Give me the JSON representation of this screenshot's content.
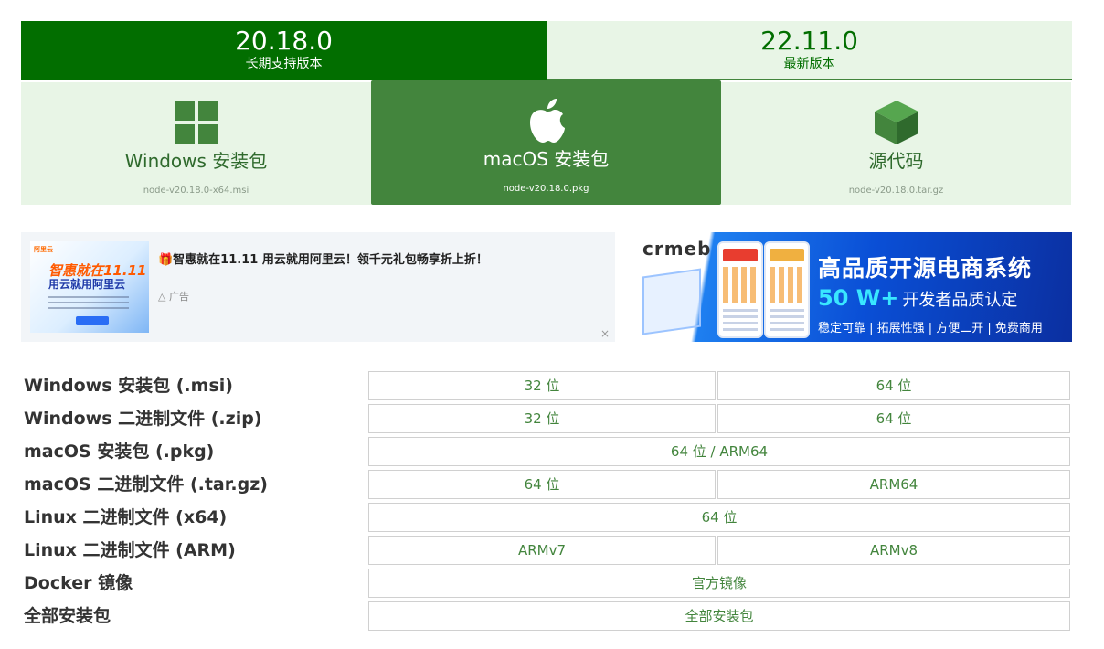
{
  "versions": {
    "lts": {
      "version": "20.18.0",
      "label": "长期支持版本"
    },
    "current": {
      "version": "22.11.0",
      "label": "最新版本"
    }
  },
  "packages": [
    {
      "title": "Windows 安装包",
      "file": "node-v20.18.0-x64.msi",
      "icon": "windows-icon"
    },
    {
      "title": "macOS 安装包",
      "file": "node-v20.18.0.pkg",
      "icon": "apple-icon",
      "selected": true
    },
    {
      "title": "源代码",
      "file": "node-v20.18.0.tar.gz",
      "icon": "box-icon"
    }
  ],
  "ad_left": {
    "thumb_brand": "阿里云",
    "thumb_headline": "智惠就在11.11",
    "thumb_headline2": "用云就用阿里云",
    "title": "🎁智惠就在11.11 用云就用阿里云！领千元礼包畅享折上折！",
    "label": "广告",
    "close": "×"
  },
  "ad_right": {
    "logo": "crmeb",
    "title": "高品质开源电商系统",
    "highlight": "50 W+",
    "subtitle": "开发者品质认定",
    "tagline": "稳定可靠 | 拓展性强 | 方便二开 | 免费商用"
  },
  "downloads": [
    {
      "label": "Windows 安装包 (.msi)",
      "links": [
        "32 位",
        "64 位"
      ]
    },
    {
      "label": "Windows 二进制文件 (.zip)",
      "links": [
        "32 位",
        "64 位"
      ]
    },
    {
      "label": "macOS 安装包 (.pkg)",
      "links": [
        "64 位 / ARM64"
      ]
    },
    {
      "label": "macOS 二进制文件 (.tar.gz)",
      "links": [
        "64 位",
        "ARM64"
      ]
    },
    {
      "label": "Linux 二进制文件 (x64)",
      "links": [
        "64 位"
      ]
    },
    {
      "label": "Linux 二进制文件 (ARM)",
      "links": [
        "ARMv7",
        "ARMv8"
      ]
    },
    {
      "label": "Docker 镜像",
      "links": [
        "官方镜像"
      ]
    },
    {
      "label": "全部安装包",
      "links": [
        "全部安装包"
      ]
    }
  ],
  "colors": {
    "lts_bg": "#026e00",
    "tab_bg": "#e8f5e6",
    "selected_bg": "#43853d",
    "link": "#43853d"
  }
}
